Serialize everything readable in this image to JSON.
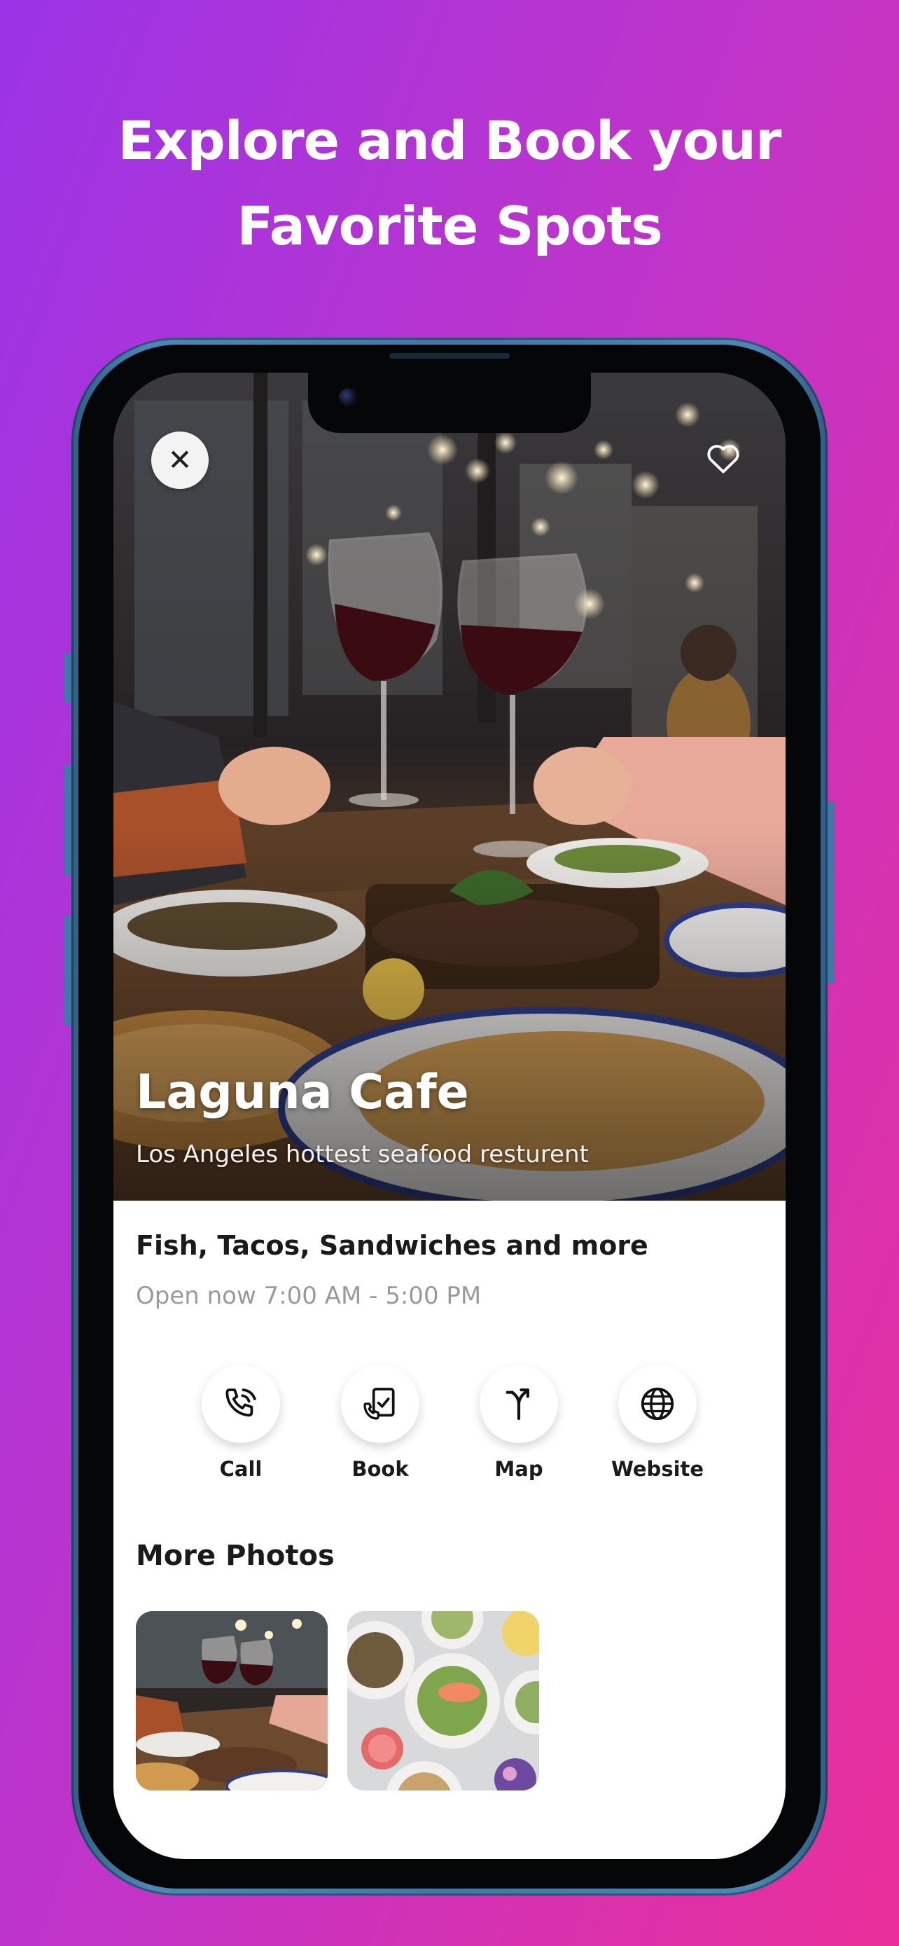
{
  "headline": {
    "line1": "Explore and Book your",
    "line2": "Favorite Spots"
  },
  "place": {
    "name": "Laguna Cafe",
    "tagline": "Los Angeles hottest seafood resturent",
    "cuisine": "Fish, Tacos, Sandwiches and more",
    "hours": "Open now 7:00 AM - 5:00 PM"
  },
  "actions": [
    {
      "label": "Call",
      "icon": "phone-call-icon"
    },
    {
      "label": "Book",
      "icon": "book-checklist-icon"
    },
    {
      "label": "Map",
      "icon": "directions-icon"
    },
    {
      "label": "Website",
      "icon": "globe-icon"
    }
  ],
  "more_photos": {
    "title": "More Photos",
    "items": [
      "wine-toast-photo",
      "seafood-dishes-photo"
    ]
  },
  "controls": {
    "close_icon": "close-icon",
    "favorite_icon": "heart-outline-icon"
  },
  "colors": {
    "gradient_start": "#9b34e6",
    "gradient_end": "#ea2f9a",
    "phone_frame": "#3f7aa6"
  }
}
